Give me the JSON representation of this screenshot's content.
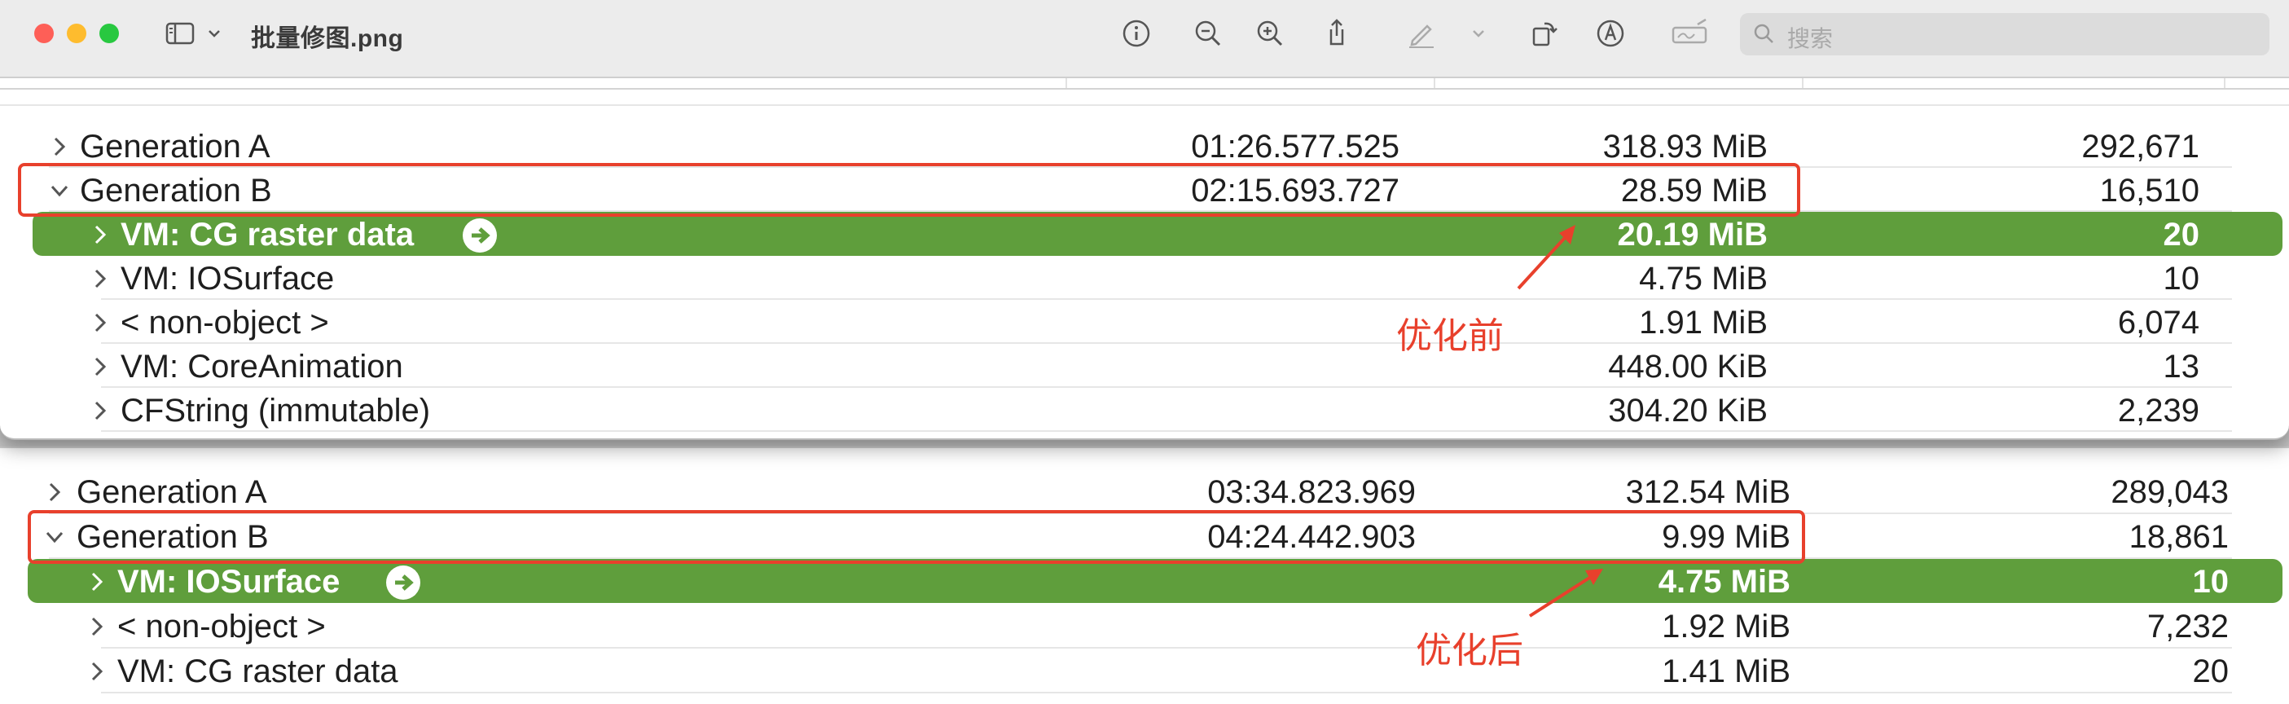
{
  "window": {
    "title": "批量修图.png",
    "search_placeholder": "搜索"
  },
  "toolbar_icons": [
    "sidebar-icon",
    "chevron-down-icon",
    "info-icon",
    "zoom-out-icon",
    "zoom-in-icon",
    "share-icon",
    "markup-pen-icon",
    "chevron-down-icon",
    "rotate-icon",
    "markup-icon",
    "sign-icon"
  ],
  "colors": {
    "selection": "#5f9e3c",
    "annotation": "#e8402c",
    "close": "#fe5f57",
    "minimize": "#febc2e",
    "zoom": "#28c840"
  },
  "before": {
    "label": "优化前",
    "rows": [
      {
        "name": "Generation A",
        "time": "01:26.577.525",
        "size": "318.93 MiB",
        "count": "292,671",
        "expanded": false,
        "indent": 0
      },
      {
        "name": "Generation B",
        "time": "02:15.693.727",
        "size": "28.59 MiB",
        "count": "16,510",
        "expanded": true,
        "indent": 0
      },
      {
        "name": "VM: CG raster data",
        "time": "",
        "size": "20.19 MiB",
        "count": "20",
        "expanded": false,
        "indent": 1,
        "selected": true
      },
      {
        "name": "VM: IOSurface",
        "time": "",
        "size": "4.75 MiB",
        "count": "10",
        "expanded": false,
        "indent": 1
      },
      {
        "name": "< non-object >",
        "time": "",
        "size": "1.91 MiB",
        "count": "6,074",
        "expanded": false,
        "indent": 1
      },
      {
        "name": "VM: CoreAnimation",
        "time": "",
        "size": "448.00 KiB",
        "count": "13",
        "expanded": false,
        "indent": 1
      },
      {
        "name": "CFString (immutable)",
        "time": "",
        "size": "304.20 KiB",
        "count": "2,239",
        "expanded": false,
        "indent": 1
      }
    ]
  },
  "after": {
    "label": "优化后",
    "rows": [
      {
        "name": "Generation A",
        "time": "03:34.823.969",
        "size": "312.54 MiB",
        "count": "289,043",
        "expanded": false,
        "indent": 0
      },
      {
        "name": "Generation B",
        "time": "04:24.442.903",
        "size": "9.99 MiB",
        "count": "18,861",
        "expanded": true,
        "indent": 0
      },
      {
        "name": "VM: IOSurface",
        "time": "",
        "size": "4.75 MiB",
        "count": "10",
        "expanded": false,
        "indent": 1,
        "selected": true
      },
      {
        "name": "< non-object >",
        "time": "",
        "size": "1.92 MiB",
        "count": "7,232",
        "expanded": false,
        "indent": 1
      },
      {
        "name": "VM: CG raster data",
        "time": "",
        "size": "1.41 MiB",
        "count": "20",
        "expanded": false,
        "indent": 1
      }
    ]
  }
}
